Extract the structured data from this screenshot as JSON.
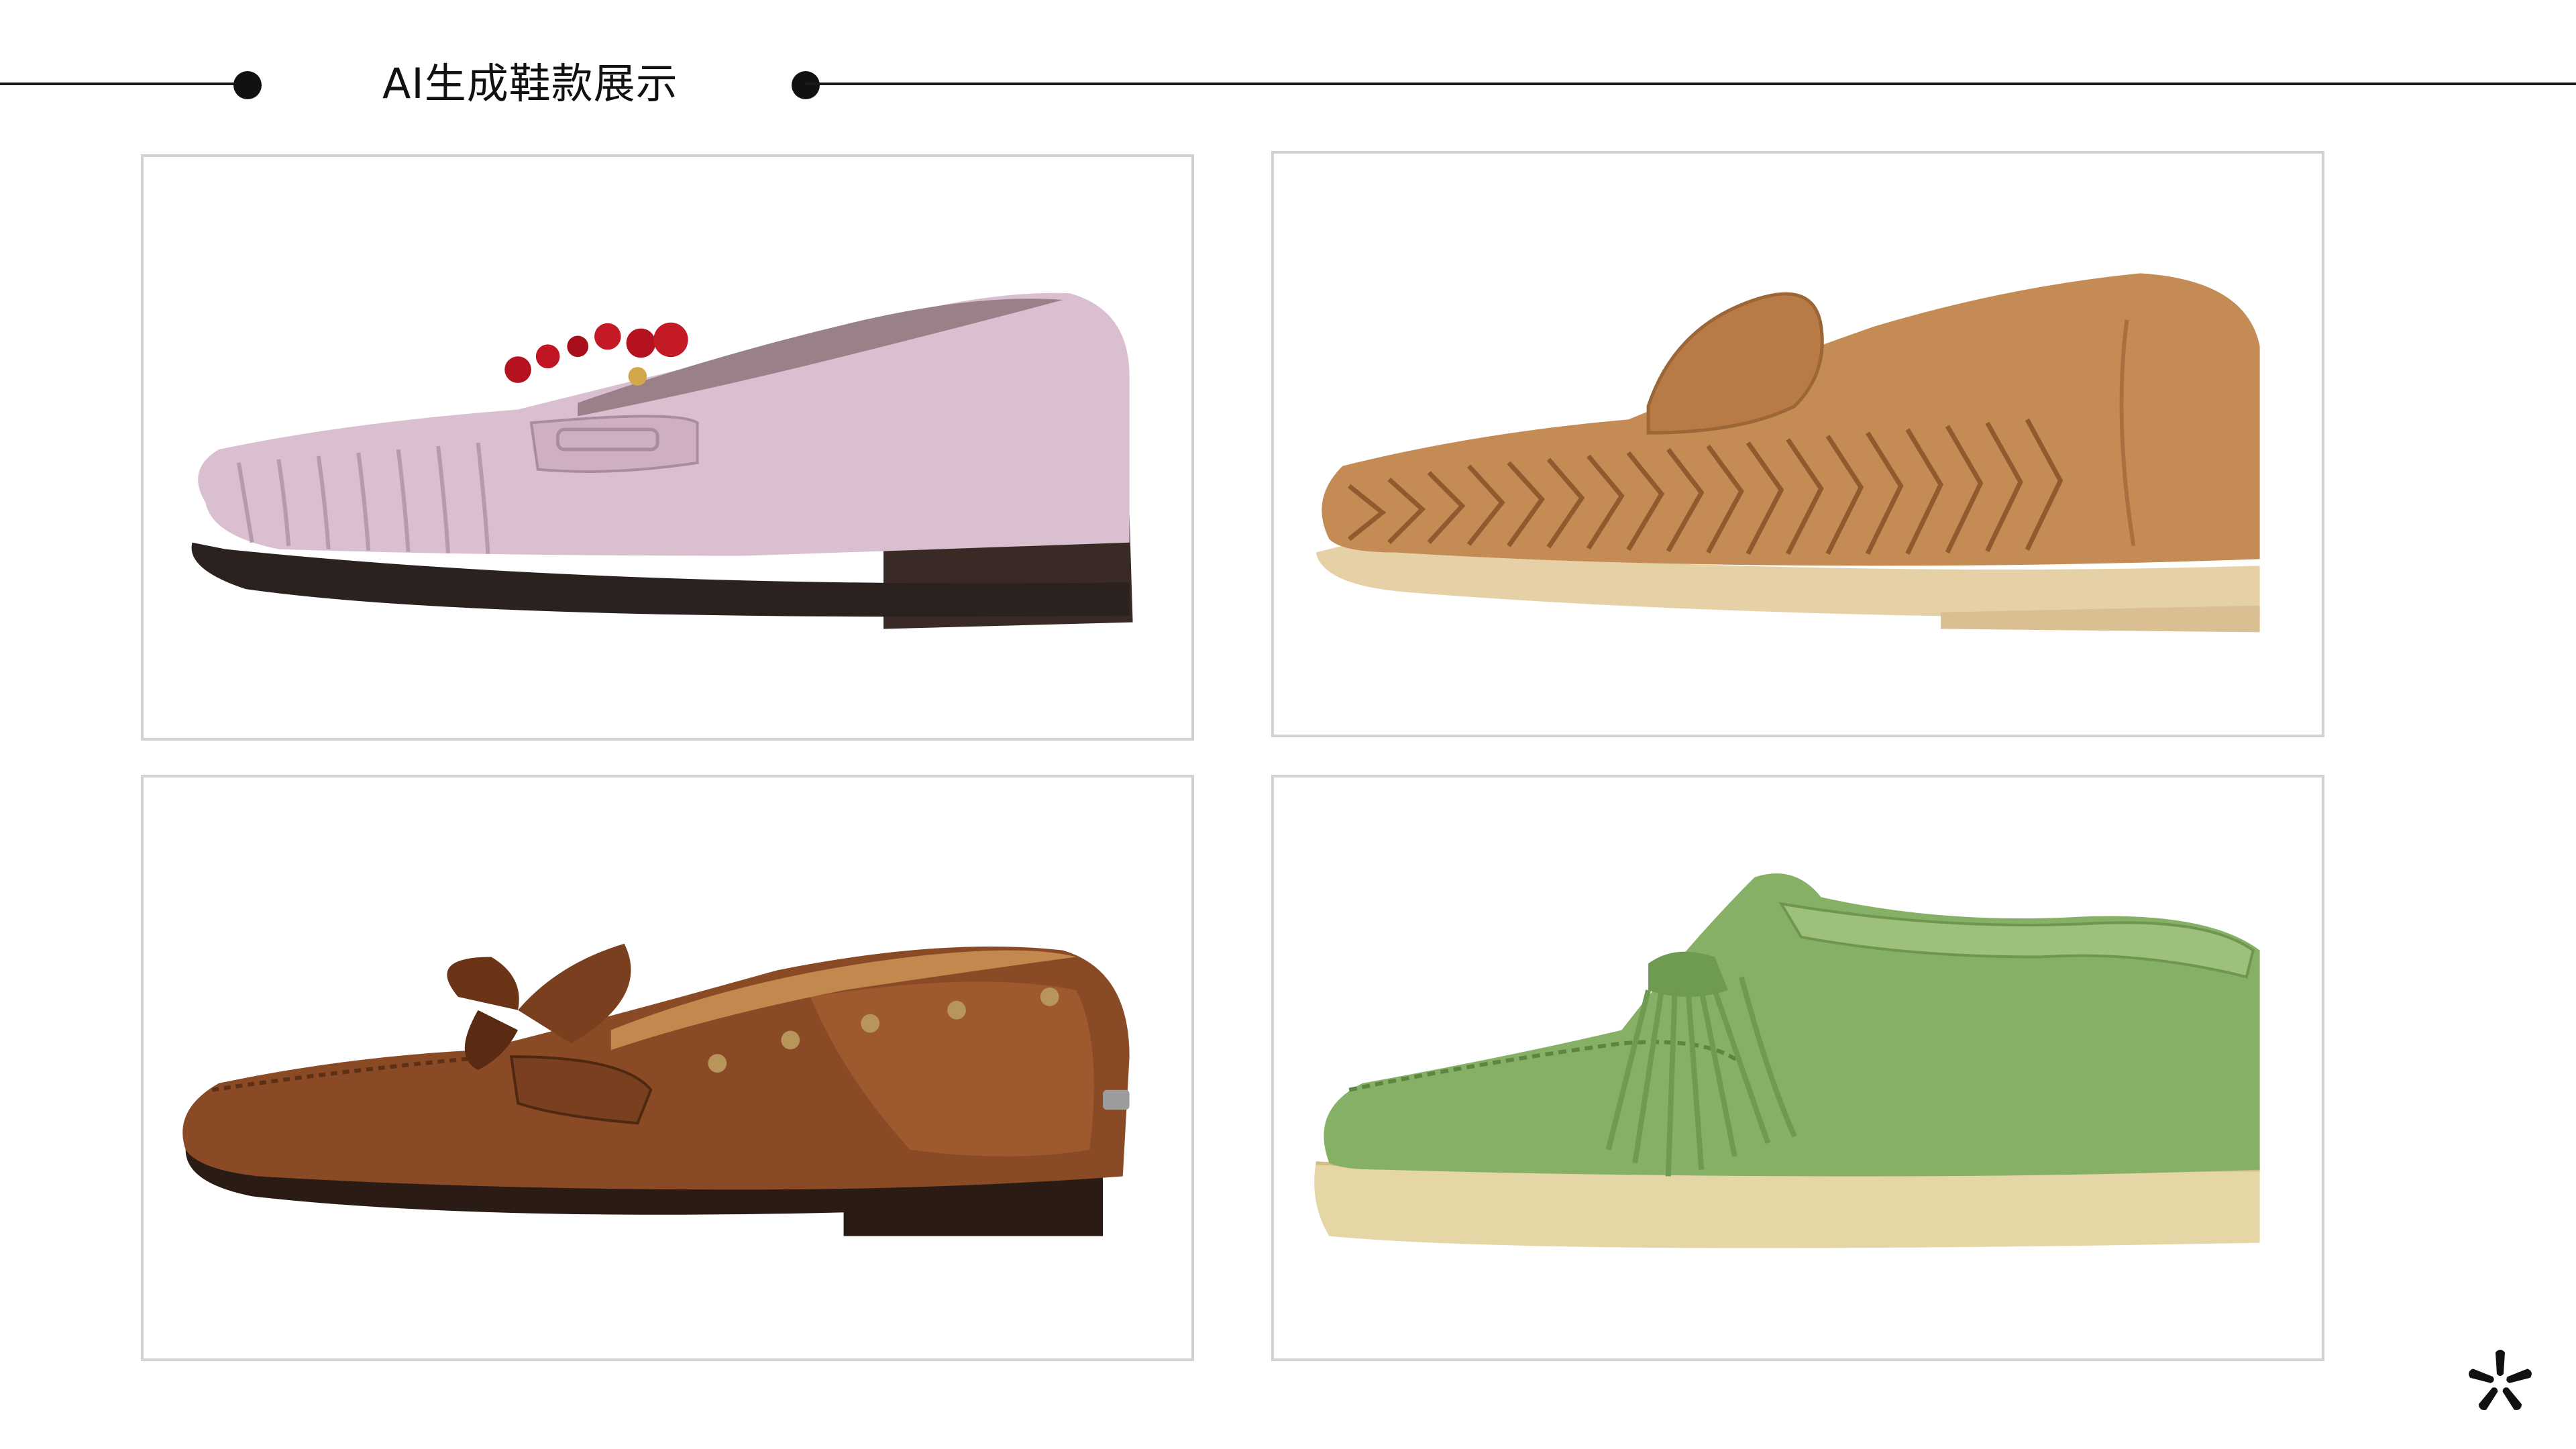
{
  "page": {
    "title": "AI生成鞋款展示"
  },
  "gallery": {
    "items": [
      {
        "id": "pink-suede-loafer",
        "icon": "pink-suede-loafer-with-red-bead-charm",
        "color": "#d9bfcf"
      },
      {
        "id": "tan-woven-loafer",
        "icon": "tan-suede-woven-penny-loafer",
        "color": "#c48b55"
      },
      {
        "id": "brown-leather-bow-loafer",
        "icon": "brown-leather-bow-loafer-with-studs",
        "color": "#8a4a25"
      },
      {
        "id": "green-suede-wallabee",
        "icon": "green-suede-moccasin-with-tassel",
        "color": "#86b065"
      }
    ]
  },
  "brand": {
    "icon": "asterisk-logo-icon"
  },
  "colors": {
    "line": "#1a1a1a",
    "card_border": "#d2d2d2",
    "background": "#ffffff"
  }
}
